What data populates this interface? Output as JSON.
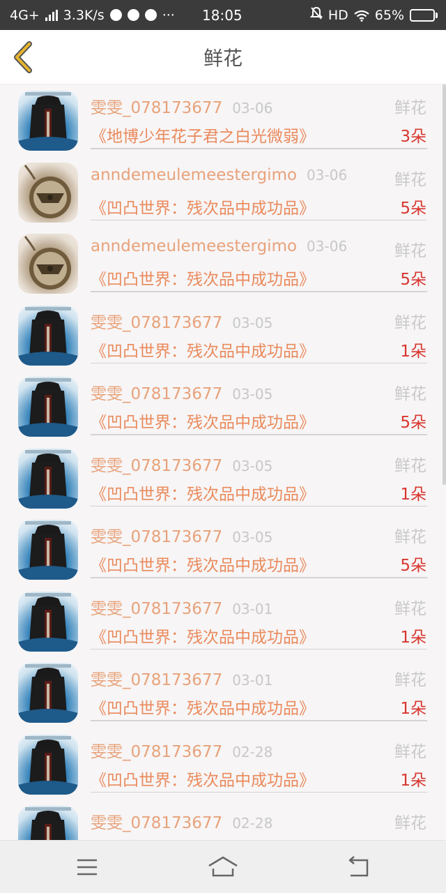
{
  "status_bar": {
    "network": "4G+",
    "speed": "3.3K/s",
    "more": "···",
    "time": "18:05",
    "hd": "HD",
    "battery": "65%",
    "battery_level": 0.65
  },
  "header": {
    "title": "鲜花"
  },
  "list": {
    "items": [
      {
        "user": "雯雯_078173677",
        "date": "03-06",
        "type": "鲜花",
        "work": "《地博少年花子君之白光微弱》",
        "count": "3朵"
      },
      {
        "user": "anndemeulemeestergimo",
        "date": "03-06",
        "type": "鲜花",
        "work": "《凹凸世界：残次品中成功品》",
        "count": "5朵"
      },
      {
        "user": "anndemeulemeestergimo",
        "date": "03-06",
        "type": "鲜花",
        "work": "《凹凸世界：残次品中成功品》",
        "count": "5朵"
      },
      {
        "user": "雯雯_078173677",
        "date": "03-05",
        "type": "鲜花",
        "work": "《凹凸世界：残次品中成功品》",
        "count": "1朵"
      },
      {
        "user": "雯雯_078173677",
        "date": "03-05",
        "type": "鲜花",
        "work": "《凹凸世界：残次品中成功品》",
        "count": "5朵"
      },
      {
        "user": "雯雯_078173677",
        "date": "03-05",
        "type": "鲜花",
        "work": "《凹凸世界：残次品中成功品》",
        "count": "1朵"
      },
      {
        "user": "雯雯_078173677",
        "date": "03-05",
        "type": "鲜花",
        "work": "《凹凸世界：残次品中成功品》",
        "count": "5朵"
      },
      {
        "user": "雯雯_078173677",
        "date": "03-01",
        "type": "鲜花",
        "work": "《凹凸世界：残次品中成功品》",
        "count": "1朵"
      },
      {
        "user": "雯雯_078173677",
        "date": "03-01",
        "type": "鲜花",
        "work": "《凹凸世界：残次品中成功品》",
        "count": "1朵"
      },
      {
        "user": "雯雯_078173677",
        "date": "02-28",
        "type": "鲜花",
        "work": "《凹凸世界：残次品中成功品》",
        "count": "1朵"
      },
      {
        "user": "雯雯_078173677",
        "date": "02-28",
        "type": "鲜花",
        "work": "",
        "count": ""
      }
    ]
  },
  "icons": {
    "back": "chevron-left-icon",
    "nav_menu": "menu-icon",
    "nav_home": "home-icon",
    "nav_back": "back-arrow-icon"
  },
  "colors": {
    "user_name": "#e8a27a",
    "work_title": "#ea8a5c",
    "count": "#d8362f",
    "back_chevron": "#e6b52e"
  }
}
